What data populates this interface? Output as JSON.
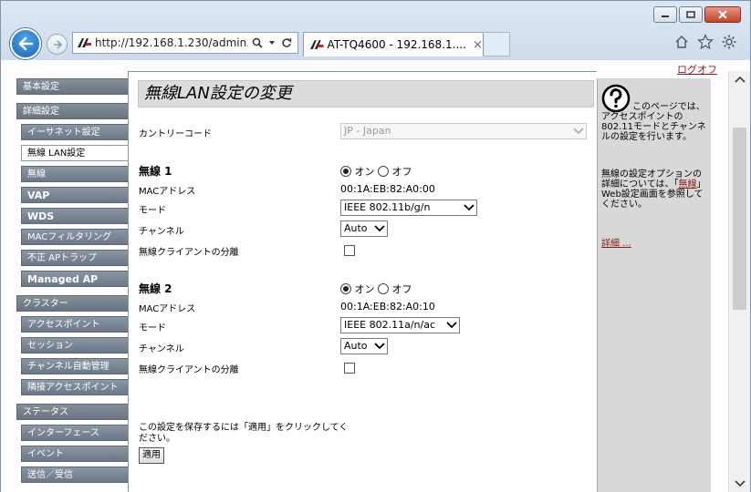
{
  "browser": {
    "url": "http://192.168.1.230/admin.",
    "tab_title": "AT-TQ4600 - 192.168.1....",
    "tab_close": "×"
  },
  "page": {
    "logoff": "ログオフ",
    "title": "無線LAN設定の変更"
  },
  "sidebar": {
    "basic": "基本設定",
    "advanced": "詳細設定",
    "ethernet": "イーサネット設定",
    "wlan": "無線 LAN設定",
    "wireless": "無線",
    "vap": "VAP",
    "wds": "WDS",
    "mac_filter": "MACフィルタリング",
    "rogue_ap": "不正 APトラップ",
    "managed_ap": "Managed AP",
    "cluster": "クラスター",
    "access_point": "アクセスポイント",
    "session": "セッション",
    "auto_channel": "チャンネル自動管理",
    "neighbor_ap": "隣接アクセスポイント",
    "status": "ステータス",
    "interface": "インターフェース",
    "event": "イベント",
    "txrx": "送信／受信"
  },
  "form": {
    "country_label": "カントリーコード",
    "country_value": "JP - Japan",
    "radio1": {
      "title": "無線 1",
      "on": "オン",
      "off": "オフ",
      "mac_label": "MACアドレス",
      "mac": "00:1A:EB:82:A0:00",
      "mode_label": "モード",
      "mode": "IEEE 802.11b/g/n",
      "channel_label": "チャンネル",
      "channel": "Auto",
      "isolation_label": "無線クライアントの分離"
    },
    "radio2": {
      "title": "無線 2",
      "on": "オン",
      "off": "オフ",
      "mac_label": "MACアドレス",
      "mac": "00:1A:EB:82:A0:10",
      "mode_label": "モード",
      "mode": "IEEE 802.11a/n/ac",
      "channel_label": "チャンネル",
      "channel": "Auto",
      "isolation_label": "無線クライアントの分離"
    },
    "save_note": "この設定を保存するには「適用」をクリックしてください。",
    "apply": "適用"
  },
  "help": {
    "intro": "このページでは、アクセスポイントの802.11モードとチャンネルの設定を行います。",
    "more_prefix": "無線の設定オプションの詳細については、「",
    "more_link": "無線",
    "more_suffix": "」Web設定画面を参照してください。",
    "detail": "詳細 ..."
  }
}
